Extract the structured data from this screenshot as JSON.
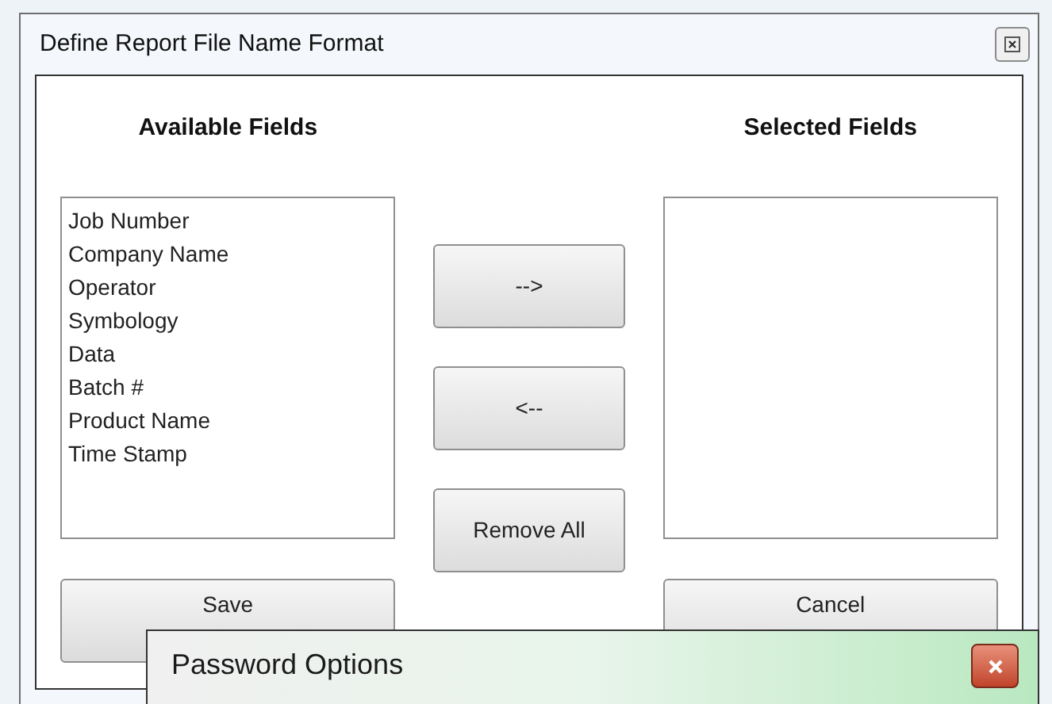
{
  "window": {
    "title": "Define Report File Name Format"
  },
  "available_fields": {
    "heading": "Available Fields",
    "items": [
      "Job Number",
      "Company Name",
      "Operator",
      "Symbology",
      "Data",
      "Batch #",
      "Product Name",
      "Time Stamp"
    ]
  },
  "selected_fields": {
    "heading": "Selected Fields"
  },
  "move_buttons": [
    "-->",
    "<--",
    "Remove All"
  ],
  "footer_buttons": [
    "Save",
    "Cancel"
  ],
  "overlay_window": {
    "title": "Password Options"
  }
}
